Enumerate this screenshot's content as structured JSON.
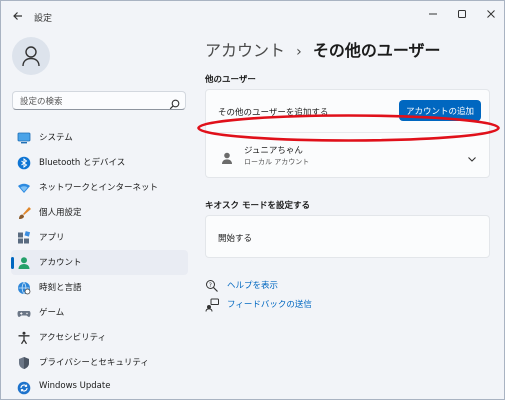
{
  "window": {
    "title": "設定",
    "controls": [
      "minimize",
      "maximize",
      "close"
    ]
  },
  "search": {
    "placeholder": "設定の検索"
  },
  "sidebar": {
    "items": [
      {
        "label": "システム",
        "icon": "system-icon"
      },
      {
        "label": "Bluetooth とデバイス",
        "icon": "bluetooth-icon"
      },
      {
        "label": "ネットワークとインターネット",
        "icon": "network-icon"
      },
      {
        "label": "個人用設定",
        "icon": "personalization-brush-icon"
      },
      {
        "label": "アプリ",
        "icon": "apps-icon"
      },
      {
        "label": "アカウント",
        "icon": "accounts-icon",
        "active": true
      },
      {
        "label": "時刻と言語",
        "icon": "time-language-icon"
      },
      {
        "label": "ゲーム",
        "icon": "gaming-icon"
      },
      {
        "label": "アクセシビリティ",
        "icon": "accessibility-icon"
      },
      {
        "label": "プライバシーとセキュリティ",
        "icon": "privacy-shield-icon"
      },
      {
        "label": "Windows Update",
        "icon": "windows-update-icon"
      }
    ]
  },
  "breadcrumb": {
    "parent": "アカウント",
    "separator": "›",
    "current": "その他のユーザー"
  },
  "other_users": {
    "heading": "他のユーザー",
    "add_label": "その他のユーザーを追加する",
    "add_button": "アカウントの追加",
    "user": {
      "name": "ジュニアちゃん",
      "type": "ローカル アカウント"
    }
  },
  "kiosk": {
    "heading": "キオスク モードを設定する",
    "start_label": "開始する"
  },
  "links": {
    "help": "ヘルプを表示",
    "feedback": "フィードバックの送信"
  },
  "colors": {
    "accent": "#0067c0",
    "annotation": "#e0101a"
  }
}
